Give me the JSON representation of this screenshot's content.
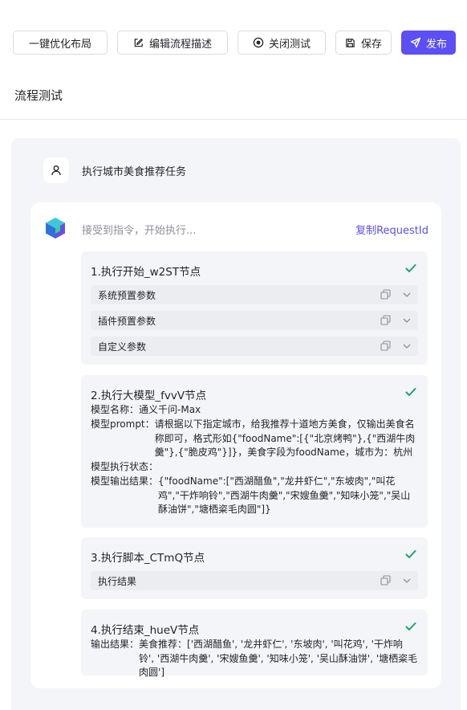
{
  "toolbar": {
    "auto_layout": "一键优化布局",
    "edit_desc": "编辑流程描述",
    "close_test": "关闭测试",
    "save": "保存",
    "publish": "发布"
  },
  "page": {
    "title": "流程测试"
  },
  "chat": {
    "user_message": "执行城市美食推荐任务",
    "status": "接受到指令，开始执行...",
    "copy_request_id": "复制RequestId"
  },
  "steps": [
    {
      "title": "1.执行开始_w2ST节点",
      "params": [
        "系统预置参数",
        "插件预置参数",
        "自定义参数"
      ]
    },
    {
      "title": "2.执行大模型_fvvV节点",
      "model_name_label": "模型名称：",
      "model_name": "通义千问-Max",
      "prompt_label": "模型prompt：",
      "prompt": "请根据以下指定城市，给我推荐十道地方美食，仅输出美食名称即可，格式形如{\"foodName\":[{\"北京烤鸭\"},{\"西湖牛肉羹\"},{\"脆皮鸡\"}]}，美食字段为foodName，城市为：杭州",
      "status_label": "模型执行状态：",
      "status": "",
      "output_label": "模型输出结果：",
      "output": "{\"foodName\":[\"西湖醋鱼\",\"龙井虾仁\",\"东坡肉\",\"叫花鸡\",\"干炸响铃\",\"西湖牛肉羹\",\"宋嫂鱼羹\",\"知味小笼\",\"吴山酥油饼\",\"塘栖粢毛肉圆\"]}"
    },
    {
      "title": "3.执行脚本_CTmQ节点",
      "params": [
        "执行结果"
      ]
    },
    {
      "title": "4.执行结束_hueV节点",
      "output_label": "输出结果：",
      "output": "美食推荐：['西湖醋鱼', '龙井虾仁', '东坡肉', '叫花鸡', '干炸响铃', '西湖牛肉羹', '宋嫂鱼羹', '知味小笼', '吴山酥油饼', '塘栖粢毛肉圆']"
    }
  ],
  "colors": {
    "accent": "#5b4ff5",
    "success": "#1aa36f"
  },
  "icons": [
    "edit-icon",
    "radio-icon",
    "save-icon",
    "send-icon",
    "user-icon",
    "bot-logo",
    "check-icon",
    "copy-icon",
    "chevron-down-icon"
  ]
}
